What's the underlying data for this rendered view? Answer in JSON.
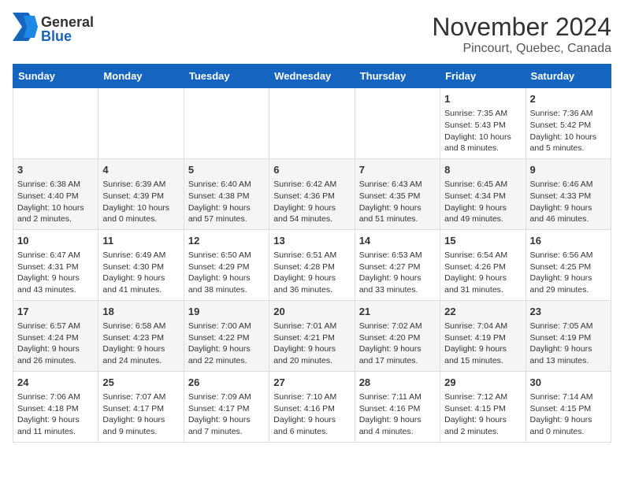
{
  "logo": {
    "general": "General",
    "blue": "Blue"
  },
  "title": "November 2024",
  "subtitle": "Pincourt, Quebec, Canada",
  "days_of_week": [
    "Sunday",
    "Monday",
    "Tuesday",
    "Wednesday",
    "Thursday",
    "Friday",
    "Saturday"
  ],
  "weeks": [
    [
      {
        "day": "",
        "info": ""
      },
      {
        "day": "",
        "info": ""
      },
      {
        "day": "",
        "info": ""
      },
      {
        "day": "",
        "info": ""
      },
      {
        "day": "",
        "info": ""
      },
      {
        "day": "1",
        "info": "Sunrise: 7:35 AM\nSunset: 5:43 PM\nDaylight: 10 hours and 8 minutes."
      },
      {
        "day": "2",
        "info": "Sunrise: 7:36 AM\nSunset: 5:42 PM\nDaylight: 10 hours and 5 minutes."
      }
    ],
    [
      {
        "day": "3",
        "info": "Sunrise: 6:38 AM\nSunset: 4:40 PM\nDaylight: 10 hours and 2 minutes."
      },
      {
        "day": "4",
        "info": "Sunrise: 6:39 AM\nSunset: 4:39 PM\nDaylight: 10 hours and 0 minutes."
      },
      {
        "day": "5",
        "info": "Sunrise: 6:40 AM\nSunset: 4:38 PM\nDaylight: 9 hours and 57 minutes."
      },
      {
        "day": "6",
        "info": "Sunrise: 6:42 AM\nSunset: 4:36 PM\nDaylight: 9 hours and 54 minutes."
      },
      {
        "day": "7",
        "info": "Sunrise: 6:43 AM\nSunset: 4:35 PM\nDaylight: 9 hours and 51 minutes."
      },
      {
        "day": "8",
        "info": "Sunrise: 6:45 AM\nSunset: 4:34 PM\nDaylight: 9 hours and 49 minutes."
      },
      {
        "day": "9",
        "info": "Sunrise: 6:46 AM\nSunset: 4:33 PM\nDaylight: 9 hours and 46 minutes."
      }
    ],
    [
      {
        "day": "10",
        "info": "Sunrise: 6:47 AM\nSunset: 4:31 PM\nDaylight: 9 hours and 43 minutes."
      },
      {
        "day": "11",
        "info": "Sunrise: 6:49 AM\nSunset: 4:30 PM\nDaylight: 9 hours and 41 minutes."
      },
      {
        "day": "12",
        "info": "Sunrise: 6:50 AM\nSunset: 4:29 PM\nDaylight: 9 hours and 38 minutes."
      },
      {
        "day": "13",
        "info": "Sunrise: 6:51 AM\nSunset: 4:28 PM\nDaylight: 9 hours and 36 minutes."
      },
      {
        "day": "14",
        "info": "Sunrise: 6:53 AM\nSunset: 4:27 PM\nDaylight: 9 hours and 33 minutes."
      },
      {
        "day": "15",
        "info": "Sunrise: 6:54 AM\nSunset: 4:26 PM\nDaylight: 9 hours and 31 minutes."
      },
      {
        "day": "16",
        "info": "Sunrise: 6:56 AM\nSunset: 4:25 PM\nDaylight: 9 hours and 29 minutes."
      }
    ],
    [
      {
        "day": "17",
        "info": "Sunrise: 6:57 AM\nSunset: 4:24 PM\nDaylight: 9 hours and 26 minutes."
      },
      {
        "day": "18",
        "info": "Sunrise: 6:58 AM\nSunset: 4:23 PM\nDaylight: 9 hours and 24 minutes."
      },
      {
        "day": "19",
        "info": "Sunrise: 7:00 AM\nSunset: 4:22 PM\nDaylight: 9 hours and 22 minutes."
      },
      {
        "day": "20",
        "info": "Sunrise: 7:01 AM\nSunset: 4:21 PM\nDaylight: 9 hours and 20 minutes."
      },
      {
        "day": "21",
        "info": "Sunrise: 7:02 AM\nSunset: 4:20 PM\nDaylight: 9 hours and 17 minutes."
      },
      {
        "day": "22",
        "info": "Sunrise: 7:04 AM\nSunset: 4:19 PM\nDaylight: 9 hours and 15 minutes."
      },
      {
        "day": "23",
        "info": "Sunrise: 7:05 AM\nSunset: 4:19 PM\nDaylight: 9 hours and 13 minutes."
      }
    ],
    [
      {
        "day": "24",
        "info": "Sunrise: 7:06 AM\nSunset: 4:18 PM\nDaylight: 9 hours and 11 minutes."
      },
      {
        "day": "25",
        "info": "Sunrise: 7:07 AM\nSunset: 4:17 PM\nDaylight: 9 hours and 9 minutes."
      },
      {
        "day": "26",
        "info": "Sunrise: 7:09 AM\nSunset: 4:17 PM\nDaylight: 9 hours and 7 minutes."
      },
      {
        "day": "27",
        "info": "Sunrise: 7:10 AM\nSunset: 4:16 PM\nDaylight: 9 hours and 6 minutes."
      },
      {
        "day": "28",
        "info": "Sunrise: 7:11 AM\nSunset: 4:16 PM\nDaylight: 9 hours and 4 minutes."
      },
      {
        "day": "29",
        "info": "Sunrise: 7:12 AM\nSunset: 4:15 PM\nDaylight: 9 hours and 2 minutes."
      },
      {
        "day": "30",
        "info": "Sunrise: 7:14 AM\nSunset: 4:15 PM\nDaylight: 9 hours and 0 minutes."
      }
    ]
  ]
}
